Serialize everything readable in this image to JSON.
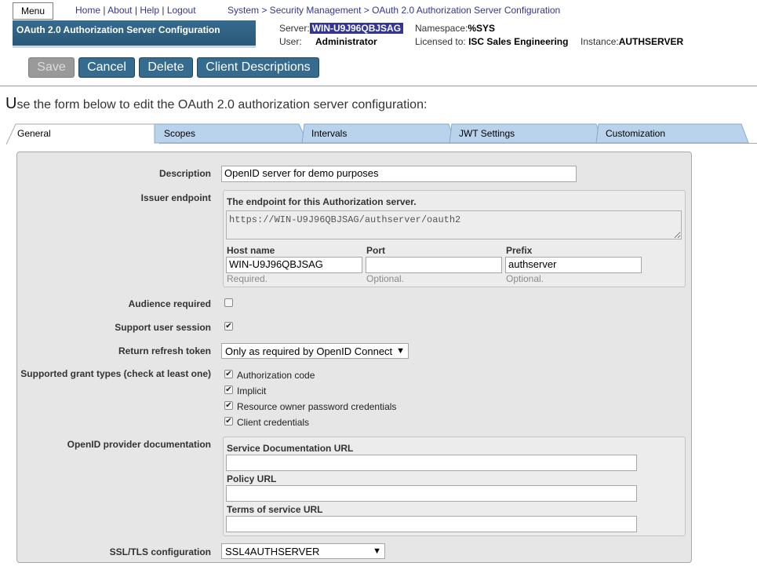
{
  "header": {
    "menu_label": "Menu",
    "links": [
      "Home",
      "About",
      "Help",
      "Logout"
    ],
    "breadcrumb": "System > Security Management > OAuth 2.0 Authorization Server Configuration",
    "title": "OAuth 2.0 Authorization Server Configuration",
    "server_label": "Server:",
    "server_value": "WIN-U9J96QBJSAG",
    "user_label": "User:",
    "user_value": "Administrator",
    "namespace_label": "Namespace:",
    "namespace_value": "%SYS",
    "licensed_label": "Licensed to:",
    "licensed_value": "ISC Sales Engineering",
    "instance_label": "Instance:",
    "instance_value": "AUTHSERVER"
  },
  "toolbar": {
    "save": "Save",
    "cancel": "Cancel",
    "delete": "Delete",
    "client_descriptions": "Client Descriptions"
  },
  "intro": {
    "first_letter": "U",
    "rest": "se the form below to edit the OAuth 2.0 authorization server configuration:"
  },
  "tabs": [
    "General",
    "Scopes",
    "Intervals",
    "JWT Settings",
    "Customization"
  ],
  "form": {
    "description_label": "Description",
    "description_value": "OpenID server for demo purposes",
    "issuer_label": "Issuer endpoint",
    "issuer_caption": "The endpoint for this Authorization server.",
    "issuer_url": "https://WIN-U9J96QBJSAG/authserver/oauth2",
    "host_label": "Host name",
    "host_value": "WIN-U9J96QBJSAG",
    "host_hint": "Required.",
    "port_label": "Port",
    "port_value": "",
    "port_hint": "Optional.",
    "prefix_label": "Prefix",
    "prefix_value": "authserver",
    "prefix_hint": "Optional.",
    "audience_label": "Audience required",
    "audience_checked": false,
    "session_label": "Support user session",
    "session_checked": true,
    "refresh_label": "Return refresh token",
    "refresh_value": "Only as required by OpenID Connect",
    "grant_label": "Supported grant types (check at least one)",
    "grants": [
      {
        "label": "Authorization code",
        "checked": true
      },
      {
        "label": "Implicit",
        "checked": true
      },
      {
        "label": "Resource owner password credentials",
        "checked": true
      },
      {
        "label": "Client credentials",
        "checked": true
      }
    ],
    "openid_label": "OpenID provider documentation",
    "service_doc_label": "Service Documentation URL",
    "service_doc_value": "",
    "policy_label": "Policy URL",
    "policy_value": "",
    "tos_label": "Terms of service URL",
    "tos_value": "",
    "ssl_label": "SSL/TLS configuration",
    "ssl_value": "SSL4AUTHSERVER"
  },
  "colors": {
    "header_blue": "#356b8e",
    "link_blue": "#333695",
    "tab_blue": "#b9d3ec",
    "panel_gray": "#e6e6e6"
  }
}
